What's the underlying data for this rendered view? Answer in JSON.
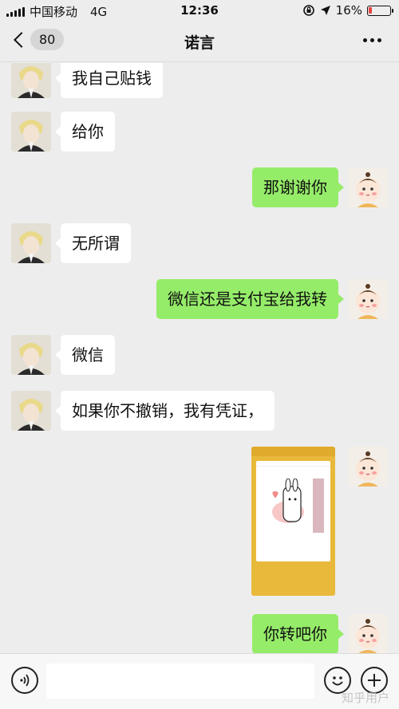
{
  "status_bar": {
    "carrier": "中国移动",
    "network": "4G",
    "time": "12:36",
    "battery": "16%",
    "battery_level": 0.16,
    "battery_color": "#e64340"
  },
  "nav": {
    "back_badge": "80",
    "title": "诺言",
    "back_icon": "chevron-left-icon",
    "more_icon": "more-dots-icon"
  },
  "messages": [
    {
      "side": "left",
      "type": "text",
      "text": "我自己贴钱"
    },
    {
      "side": "left",
      "type": "text",
      "text": "给你"
    },
    {
      "side": "right",
      "type": "text",
      "text": "那谢谢你"
    },
    {
      "side": "left",
      "type": "text",
      "text": "无所谓"
    },
    {
      "side": "right",
      "type": "text",
      "text": "微信还是支付宝给我转"
    },
    {
      "side": "left",
      "type": "text",
      "text": "微信"
    },
    {
      "side": "left",
      "type": "text",
      "text": "如果你不撤销，我有凭证，"
    },
    {
      "side": "right",
      "type": "image",
      "image_desc": "payment-qr-code-screenshot"
    },
    {
      "side": "right",
      "type": "text",
      "text": "你转吧你"
    }
  ],
  "input_bar": {
    "voice_icon": "voice-icon",
    "emoji_icon": "emoji-icon",
    "plus_icon": "plus-icon",
    "watermark": "知乎用户"
  },
  "colors": {
    "sent_bubble": "#95ec69",
    "received_bubble": "#ffffff",
    "background": "#ededed"
  }
}
